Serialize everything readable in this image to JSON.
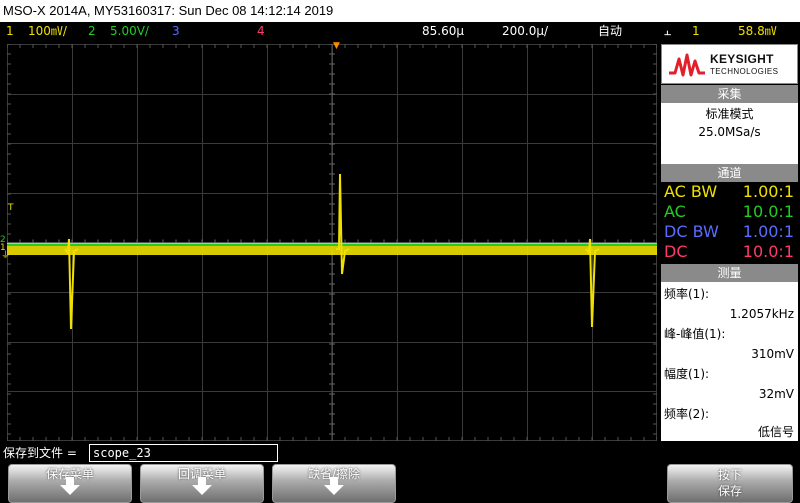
{
  "title_bar": {
    "text": "MSO-X 2014A, MY53160317: Sun Dec 08 14:12:14 2019"
  },
  "status_bar": {
    "ch1_num": "1",
    "ch1_scale": "100㎷/",
    "ch2_num": "2",
    "ch2_scale": "5.00V/",
    "ch3_num": "3",
    "ch4_num": "4",
    "trigger_delay": "85.60µ",
    "timebase": "200.0µ/",
    "mode": "自动",
    "trig_icon_glyph": "⫠",
    "trig_source": "1",
    "trig_level": "58.8㎷"
  },
  "markers": {
    "trigger_t": "T",
    "ch2": "2",
    "ch1": "1",
    "ground": "⏚",
    "trigger_arrow": "▼"
  },
  "colors": {
    "ch1": "#f0e000",
    "ch2": "#22cc22",
    "ch3": "#5a6cff",
    "ch4": "#ff3a6a",
    "accent": "#ff8c00",
    "logo": "#e0202a"
  },
  "sidebar": {
    "brand": "KEYSIGHT",
    "brand_sub": "TECHNOLOGIES",
    "acquire": {
      "title": "采集",
      "mode": "标准模式",
      "rate": "25.0MSa/s"
    },
    "channels": {
      "title": "通道",
      "rows": [
        {
          "coupling": "AC BW",
          "probe": "1.00:1"
        },
        {
          "coupling": "AC",
          "probe": "10.0:1"
        },
        {
          "coupling": "DC BW",
          "probe": "1.00:1"
        },
        {
          "coupling": "DC",
          "probe": "10.0:1"
        }
      ]
    },
    "measure": {
      "title": "测量",
      "items": [
        {
          "label": "频率(1):",
          "value": "1.2057kHz"
        },
        {
          "label": "峰-峰值(1):",
          "value": "310mV"
        },
        {
          "label": "幅度(1):",
          "value": "32mV"
        },
        {
          "label": "频率(2):",
          "value": "低信号"
        }
      ]
    }
  },
  "save_bar": {
    "label": "保存到文件 =",
    "filename": "scope_23"
  },
  "softkeys": {
    "save_menu": "保存菜单",
    "recall_menu": "回调菜单",
    "default_erase": "缺省/擦除",
    "press_line1": "按下",
    "press_line2": "保存"
  }
}
